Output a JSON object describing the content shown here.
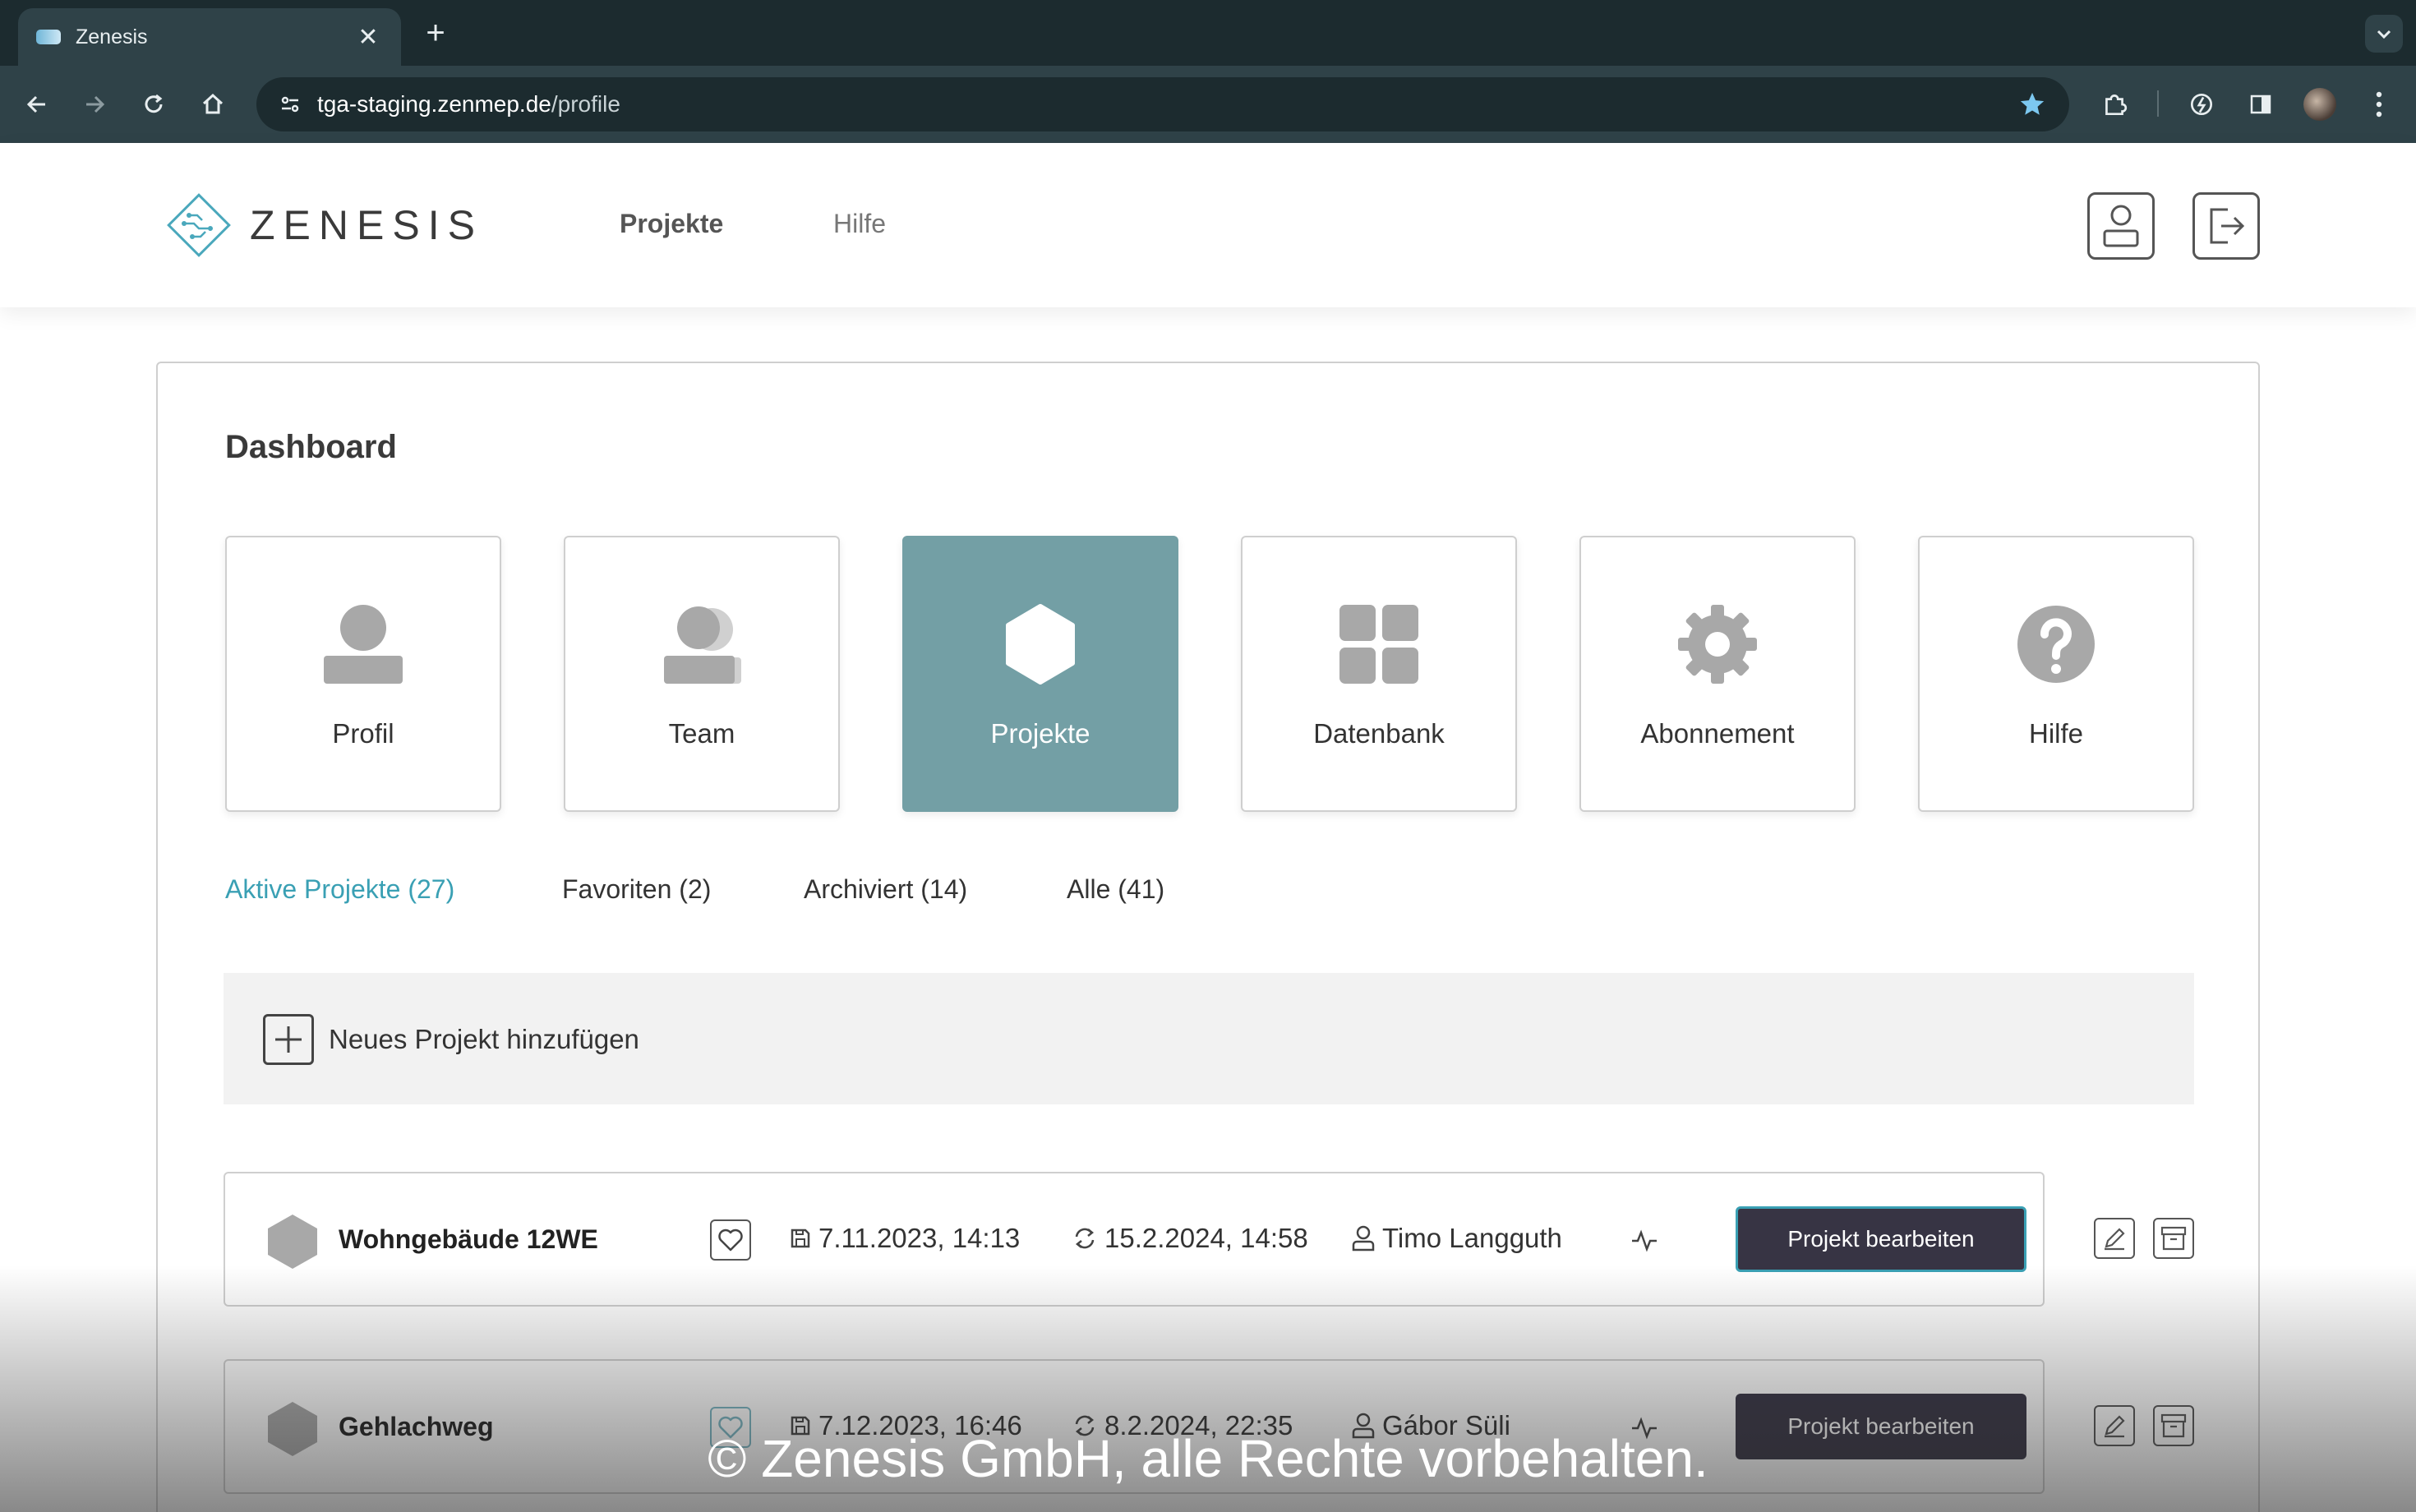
{
  "browser": {
    "tab_title": "Zenesis",
    "url_host": "tga-staging.zenmep.de",
    "url_path": "/profile"
  },
  "header": {
    "logo_text": "ZENESIS",
    "nav": [
      "Projekte",
      "Hilfe"
    ]
  },
  "dashboard": {
    "title": "Dashboard",
    "tiles": [
      {
        "label": "Profil",
        "icon": "person-icon"
      },
      {
        "label": "Team",
        "icon": "team-icon"
      },
      {
        "label": "Projekte",
        "icon": "hexagon-icon",
        "selected": true
      },
      {
        "label": "Datenbank",
        "icon": "grid-icon"
      },
      {
        "label": "Abonnement",
        "icon": "gear-icon"
      },
      {
        "label": "Hilfe",
        "icon": "question-icon"
      }
    ],
    "filters": [
      {
        "label": "Aktive Projekte (27)",
        "active": true
      },
      {
        "label": "Favoriten (2)"
      },
      {
        "label": "Archiviert (14)"
      },
      {
        "label": "Alle (41)"
      }
    ],
    "add_project_label": "Neues Projekt hinzufügen",
    "projects": [
      {
        "name": "Wohngebäude 12WE",
        "saved": "7.11.2023, 14:13",
        "synced": "15.2.2024, 14:58",
        "user": "Timo Langguth",
        "action": "Projekt bearbeiten"
      },
      {
        "name": "Gehlachweg",
        "saved": "7.12.2023, 16:46",
        "synced": "8.2.2024, 22:35",
        "user": "Gábor Süli",
        "action": "Projekt bearbeiten"
      }
    ]
  },
  "footer_note": "© Zenesis GmbH, alle Rechte vorbehalten.",
  "colors": {
    "accent": "#3aa0b4",
    "tile_selected": "#739fa5",
    "button_dark": "#373444",
    "browser_dark": "#1c2b2f",
    "browser_toolbar": "#2f4248"
  }
}
